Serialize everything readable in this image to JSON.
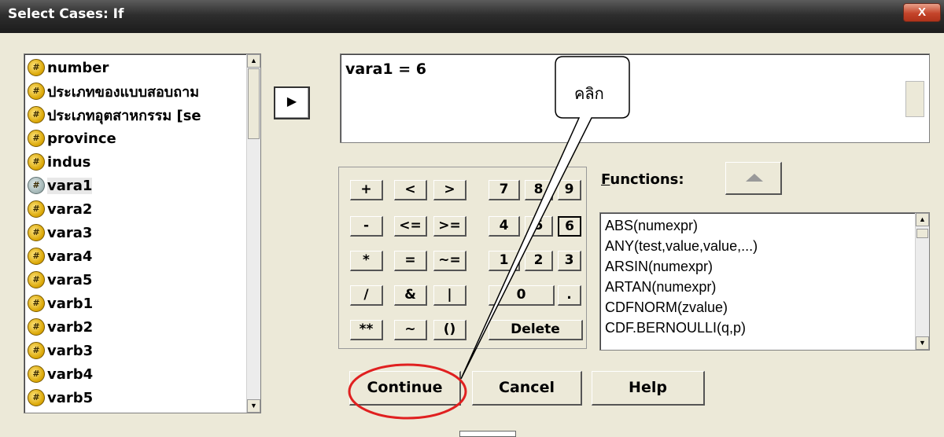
{
  "window": {
    "title": "Select Cases: If",
    "close_label": "X"
  },
  "variables": {
    "items": [
      {
        "label": "number",
        "selected": false
      },
      {
        "label": "ประเภทของแบบสอบถาม",
        "selected": false
      },
      {
        "label": "ประเภทอุตสาหกรรม [se",
        "selected": false
      },
      {
        "label": "province",
        "selected": false
      },
      {
        "label": "indus",
        "selected": false
      },
      {
        "label": "vara1",
        "selected": true
      },
      {
        "label": "vara2",
        "selected": false
      },
      {
        "label": "vara3",
        "selected": false
      },
      {
        "label": "vara4",
        "selected": false
      },
      {
        "label": "vara5",
        "selected": false
      },
      {
        "label": "varb1",
        "selected": false
      },
      {
        "label": "varb2",
        "selected": false
      },
      {
        "label": "varb3",
        "selected": false
      },
      {
        "label": "varb4",
        "selected": false
      },
      {
        "label": "varb5",
        "selected": false
      }
    ],
    "icon": "numeric-variable-icon"
  },
  "move_button": {
    "icon": "right-arrow-icon",
    "glyph": "▶"
  },
  "expression": {
    "value": "vara1 = 6"
  },
  "keypad": {
    "keys": [
      "+",
      "<",
      ">",
      "7",
      "8",
      "9",
      "-",
      "<=",
      ">=",
      "4",
      "5",
      "6",
      "*",
      "=",
      "~=",
      "1",
      "2",
      "3",
      "/",
      "&",
      "|",
      "0",
      ".",
      "**",
      "~",
      "()",
      "Delete"
    ]
  },
  "functions": {
    "label_underlined": "F",
    "label_rest": "unctions:",
    "items": [
      "ABS(numexpr)",
      "ANY(test,value,value,...)",
      "ARSIN(numexpr)",
      "ARTAN(numexpr)",
      "CDFNORM(zvalue)",
      "CDF.BERNOULLI(q,p)"
    ]
  },
  "buttons": {
    "continue": "Continue",
    "cancel": "Cancel",
    "help": "Help"
  },
  "annotation": {
    "callout_text": "คลิก",
    "highlight_color": "#e02020"
  }
}
